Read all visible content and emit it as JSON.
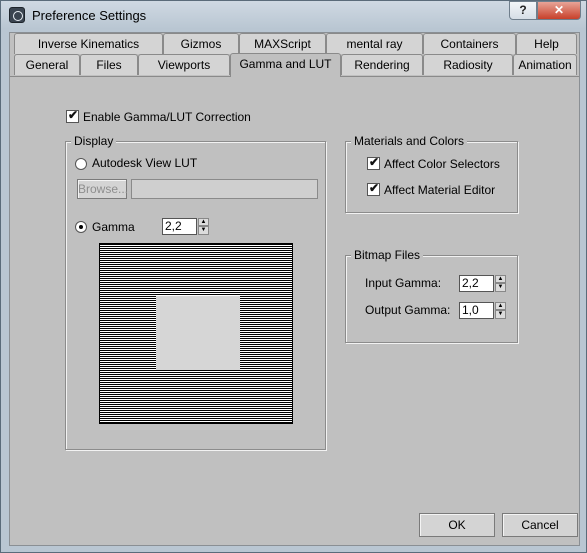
{
  "window": {
    "title": "Preference Settings",
    "help_glyph": "?",
    "close_glyph": "✕"
  },
  "tabs_row1": [
    "Inverse Kinematics",
    "Gizmos",
    "MAXScript",
    "mental ray",
    "Containers",
    "Help"
  ],
  "tabs_row2": [
    "General",
    "Files",
    "Viewports",
    "Gamma and LUT",
    "Rendering",
    "Radiosity",
    "Animation"
  ],
  "active_tab": "Gamma and LUT",
  "enable_gamma": {
    "label": "Enable Gamma/LUT Correction",
    "checked": true
  },
  "display": {
    "legend": "Display",
    "lut_radio": {
      "label": "Autodesk View LUT",
      "selected": false
    },
    "browse_label": "Browse...",
    "gamma_radio": {
      "label": "Gamma",
      "selected": true
    },
    "gamma_value": "2,2"
  },
  "materials": {
    "legend": "Materials and Colors",
    "affect_color_selectors": {
      "label": "Affect Color Selectors",
      "checked": true
    },
    "affect_material_editor": {
      "label": "Affect Material Editor",
      "checked": true
    }
  },
  "bitmap": {
    "legend": "Bitmap Files",
    "input_label": "Input Gamma:",
    "input_value": "2,2",
    "output_label": "Output Gamma:",
    "output_value": "1,0"
  },
  "footer": {
    "ok": "OK",
    "cancel": "Cancel"
  },
  "glyphs": {
    "check": "✔",
    "up": "▲",
    "down": "▼"
  }
}
